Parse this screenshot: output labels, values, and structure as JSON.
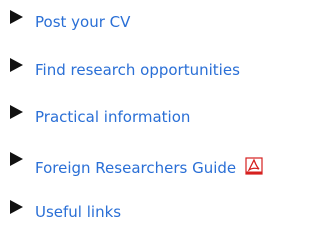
{
  "nav": {
    "items": [
      {
        "label": "Post your CV",
        "icon": "triangle-bullet-icon"
      },
      {
        "label": "Find research opportunities",
        "icon": "triangle-bullet-icon"
      },
      {
        "label": "Practical information",
        "icon": "triangle-bullet-icon"
      },
      {
        "label": "Foreign Researchers Guide",
        "icon": "triangle-bullet-icon",
        "trailing_icon": "pdf-icon"
      },
      {
        "label": "Useful links",
        "icon": "triangle-bullet-icon"
      }
    ]
  },
  "colors": {
    "link": "#2a6fd6",
    "bullet": "#111111",
    "pdf_red": "#d6201f",
    "background": "#ffffff"
  }
}
